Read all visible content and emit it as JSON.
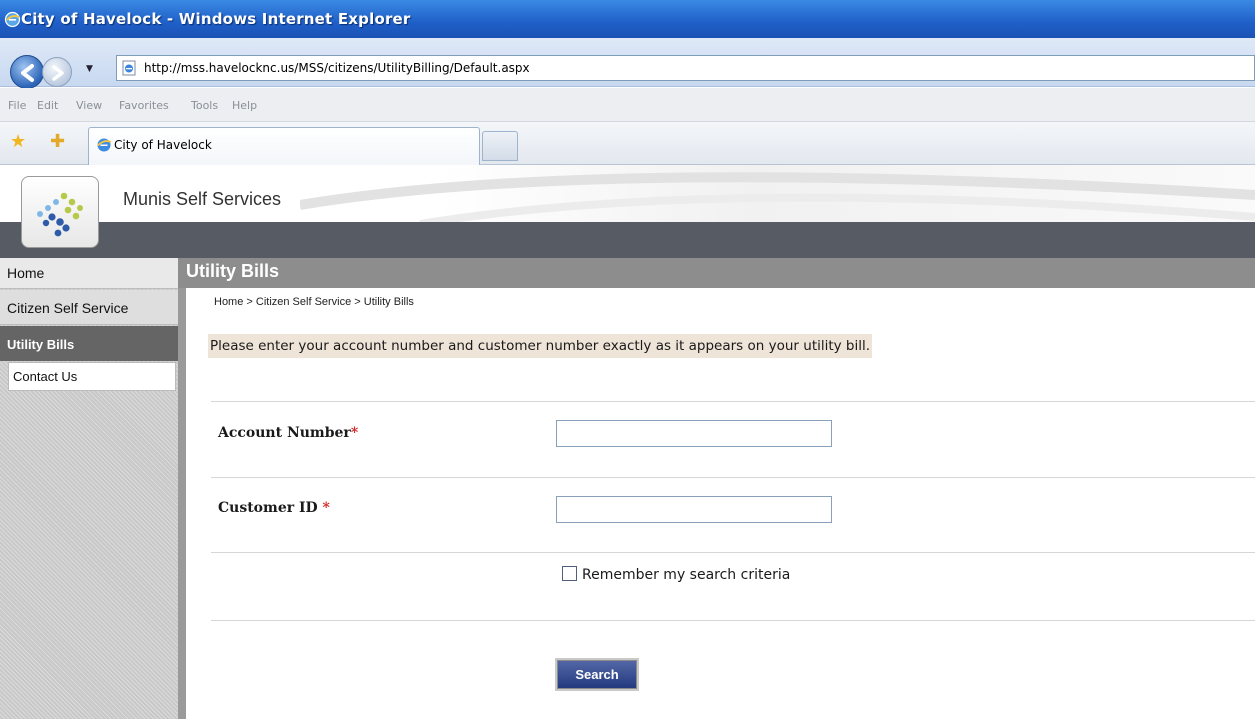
{
  "window": {
    "title": "City of Havelock - Windows Internet Explorer"
  },
  "address_bar": {
    "url": "http://mss.havelocknc.us/MSS/citizens/UtilityBilling/Default.aspx"
  },
  "menu": [
    "File",
    "Edit",
    "View",
    "Favorites",
    "Tools",
    "Help"
  ],
  "tab": {
    "label": "City of Havelock"
  },
  "app": {
    "title": "Munis Self Services"
  },
  "sidebar": {
    "items": [
      {
        "label": "Home"
      },
      {
        "label": "Citizen Self Service"
      },
      {
        "label": "Utility Bills"
      },
      {
        "label": "Contact Us"
      }
    ]
  },
  "main": {
    "header": "Utility Bills",
    "breadcrumb": "Home > Citizen Self Service > Utility Bills",
    "instructions": "Please enter your account number and customer number exactly as it appears on your utility bill."
  },
  "form": {
    "account_label": "Account Number",
    "account_value": "",
    "customer_label": "Customer ID ",
    "customer_value": "",
    "required_mark": "*",
    "remember_label": "Remember my search criteria",
    "search_label": "Search"
  },
  "colors": {
    "titlebar": "#1f5fc8",
    "darkband": "#565b64",
    "main_header": "#8d8d8d",
    "selected_nav": "#656565",
    "instructions_bg": "#efe4d8",
    "required": "#d42020",
    "search_button": "#243a80"
  },
  "icons": [
    "ie-logo-icon",
    "back-arrow-icon",
    "forward-arrow-icon",
    "page-icon",
    "favorites-star-icon",
    "add-favorite-icon",
    "munis-logo-icon"
  ]
}
